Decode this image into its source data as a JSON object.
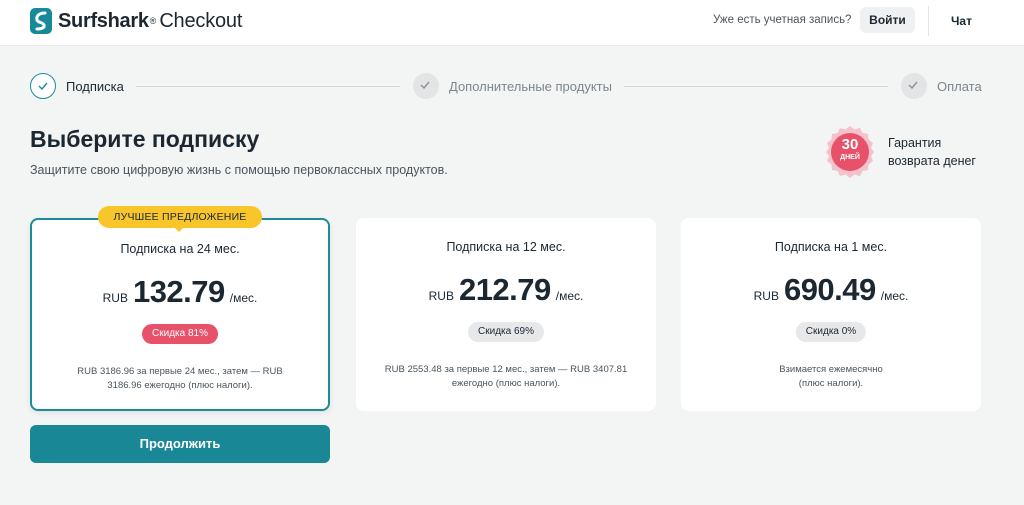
{
  "header": {
    "brand": "Surfshark",
    "brand_reg": "®",
    "checkout": "Checkout",
    "account_question": "Уже есть учетная запись?",
    "login_label": "Войти",
    "chat_label": "Чат",
    "brand_color": "#178a9a"
  },
  "steps": [
    {
      "label": "Подписка",
      "state": "active"
    },
    {
      "label": "Дополнительные продукты",
      "state": "inactive"
    },
    {
      "label": "Оплата",
      "state": "inactive"
    }
  ],
  "main": {
    "title": "Выберите подписку",
    "subtitle": "Защитите свою цифровую жизнь с помощью первоклассных продуктов."
  },
  "guarantee": {
    "badge_number": "30",
    "badge_unit": "ДНЕЙ",
    "line1": "Гарантия",
    "line2": "возврата денег",
    "badge_color": "#e8516a"
  },
  "best_offer_label": "ЛУЧШЕЕ ПРЕДЛОЖЕНИЕ",
  "plans": [
    {
      "title": "Подписка на 24 мес.",
      "currency": "RUB",
      "price": "132.79",
      "per": "/мес.",
      "discount": "Скидка 81%",
      "note_line1": "RUB 3186.96 за первые 24 мес., затем — RUB",
      "note_line2": "3186.96 ежегодно (плюс налоги).",
      "selected": true
    },
    {
      "title": "Подписка на 12 мес.",
      "currency": "RUB",
      "price": "212.79",
      "per": "/мес.",
      "discount": "Скидка 69%",
      "note_line1": "RUB 2553.48 за первые 12 мес., затем — RUB 3407.81",
      "note_line2": "ежегодно (плюс налоги).",
      "selected": false
    },
    {
      "title": "Подписка на 1 мес.",
      "currency": "RUB",
      "price": "690.49",
      "per": "/мес.",
      "discount": "Скидка 0%",
      "note_line1": "Взимается ежемесячно",
      "note_line2": "(плюс налоги).",
      "selected": false
    }
  ],
  "continue_label": "Продолжить",
  "colors": {
    "accent": "#1a8796",
    "best_tag": "#f8c52a",
    "discount_red": "#e8516a"
  }
}
